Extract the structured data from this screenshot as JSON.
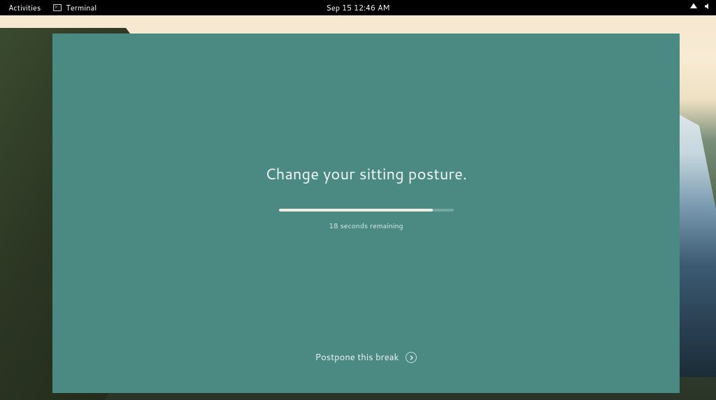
{
  "panel": {
    "activities_label": "Activities",
    "app_label": "Terminal",
    "datetime": "Sep 15  12:46 AM"
  },
  "break": {
    "message": "Change your sitting posture.",
    "remaining_text": "18 seconds remaining",
    "postpone_label": "Postpone this break",
    "progress_percent": 88
  },
  "colors": {
    "card_bg": "#4a8a82",
    "panel_bg": "#000000"
  }
}
